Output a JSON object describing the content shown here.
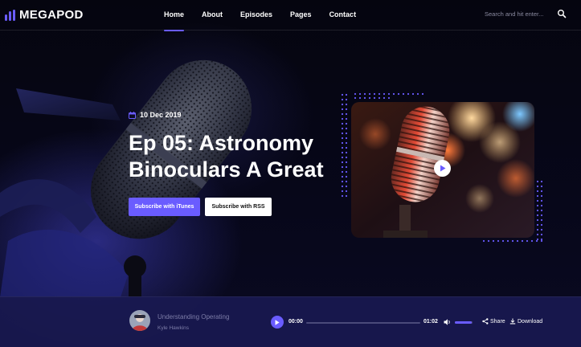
{
  "brand": {
    "name": "MEGAPOD",
    "accent": "#6a5cff"
  },
  "nav": {
    "items": [
      {
        "label": "Home",
        "active": true
      },
      {
        "label": "About",
        "active": false
      },
      {
        "label": "Episodes",
        "active": false
      },
      {
        "label": "Pages",
        "active": false
      },
      {
        "label": "Contact",
        "active": false
      }
    ]
  },
  "search": {
    "placeholder": "Search and hit enter...",
    "icon": "search-icon"
  },
  "hero": {
    "date": "10 Dec 2019",
    "date_icon": "calendar-icon",
    "title_line1": "Ep 05: Astronomy",
    "title_line2": "Binoculars A Great",
    "primary_button": "Subscribe with iTunes",
    "secondary_button": "Subscribe with RSS"
  },
  "video": {
    "play_icon": "play-icon"
  },
  "player": {
    "track_title": "Understanding Operating",
    "track_artist": "Kyle Hawkins",
    "current_time": "00:00",
    "duration": "01:02",
    "progress": 0,
    "volume": 0.95,
    "share_label": "Share",
    "download_label": "Download"
  }
}
